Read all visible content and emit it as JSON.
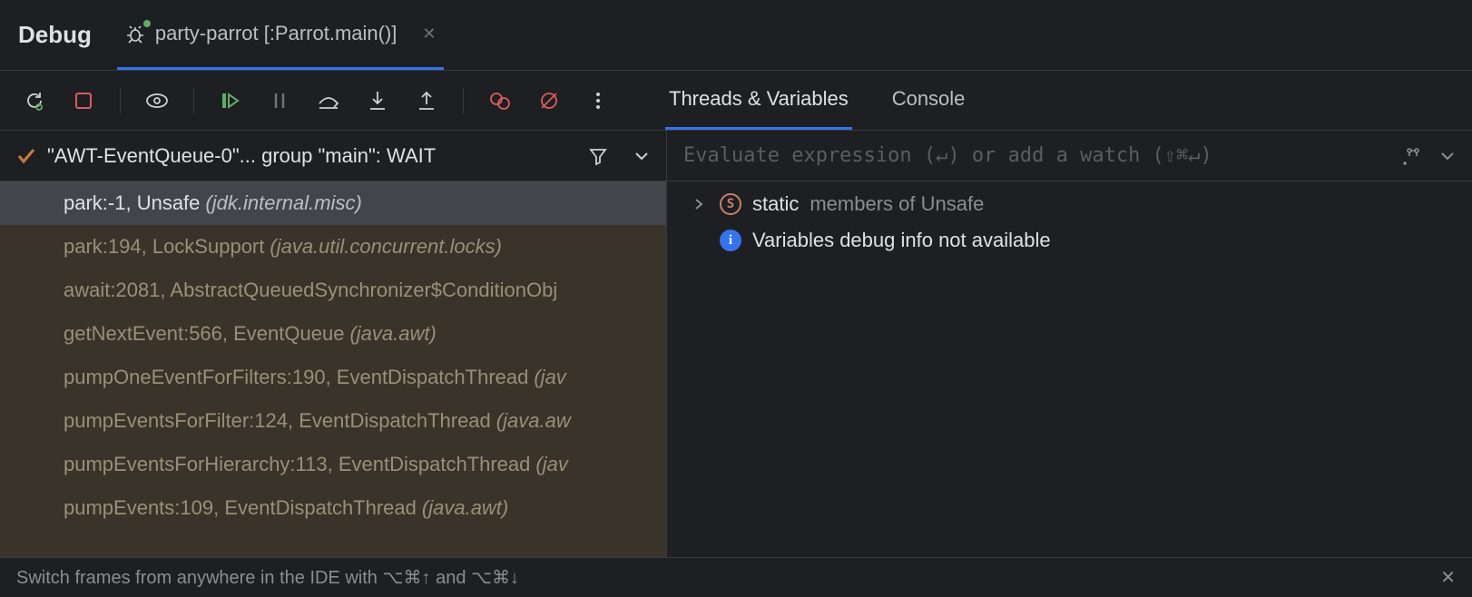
{
  "header": {
    "title": "Debug",
    "run_config": "party-parrot [:Parrot.main()]"
  },
  "tabs": {
    "threads_vars": "Threads & Variables",
    "console": "Console"
  },
  "thread": {
    "label": "\"AWT-EventQueue-0\"... group \"main\": WAIT"
  },
  "frames": [
    {
      "call": "park:-1, Unsafe",
      "pkg": "(jdk.internal.misc)",
      "selected": true
    },
    {
      "call": "park:194, LockSupport",
      "pkg": "(java.util.concurrent.locks)",
      "selected": false
    },
    {
      "call": "await:2081, AbstractQueuedSynchronizer$ConditionObj",
      "pkg": "",
      "selected": false
    },
    {
      "call": "getNextEvent:566, EventQueue",
      "pkg": "(java.awt)",
      "selected": false
    },
    {
      "call": "pumpOneEventForFilters:190, EventDispatchThread",
      "pkg": "(jav",
      "selected": false
    },
    {
      "call": "pumpEventsForFilter:124, EventDispatchThread",
      "pkg": "(java.aw",
      "selected": false
    },
    {
      "call": "pumpEventsForHierarchy:113, EventDispatchThread",
      "pkg": "(jav",
      "selected": false
    },
    {
      "call": "pumpEvents:109, EventDispatchThread",
      "pkg": "(java.awt)",
      "selected": false
    }
  ],
  "eval": {
    "placeholder": "Evaluate expression (↵) or add a watch (⇧⌘↵)"
  },
  "vars": {
    "static_label": "static",
    "static_rest": "members of Unsafe",
    "info": "Variables debug info not available"
  },
  "hint": {
    "text": "Switch frames from anywhere in the IDE with ⌥⌘↑ and ⌥⌘↓"
  }
}
